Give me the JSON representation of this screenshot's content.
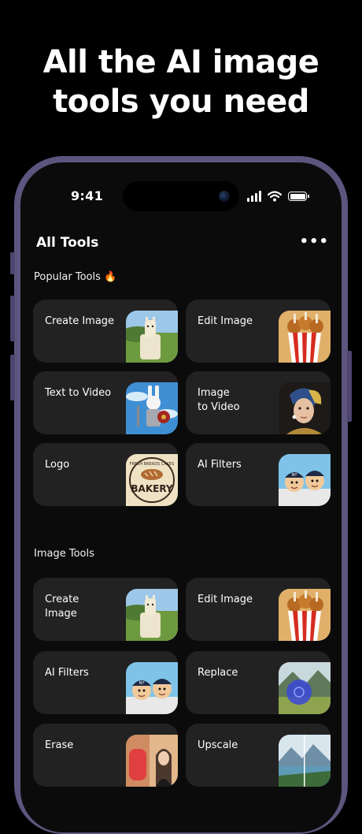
{
  "headline": [
    "All the AI image",
    "tools you need"
  ],
  "status_bar": {
    "time": "9:41"
  },
  "app": {
    "title": "All Tools",
    "more_label": "•••"
  },
  "sections": [
    {
      "title": "Popular Tools 🔥",
      "cards": [
        {
          "label": "Create Image",
          "thumb": "alpaca-image"
        },
        {
          "label": "Edit Image",
          "thumb": "fried-chicken-bucket-image"
        },
        {
          "label": "Text to Video",
          "thumb": "rabbit-knight-image"
        },
        {
          "label": "Image\nto Video",
          "thumb": "pearl-earring-portrait-image"
        },
        {
          "label": "Logo",
          "thumb": "bakery-logo-image",
          "thumb_text": [
            "FRESH BREADS CAKES",
            "BAKERY"
          ]
        },
        {
          "label": "AI Filters",
          "thumb": "cartoon-baseball-image",
          "thumb_text": [
            "NY"
          ]
        }
      ]
    },
    {
      "title": "Image Tools",
      "cards": [
        {
          "label": "Create\nImage",
          "thumb": "alpaca-image"
        },
        {
          "label": "Edit Image",
          "thumb": "fried-chicken-bucket-image"
        },
        {
          "label": "AI Filters",
          "thumb": "cartoon-baseball-image",
          "thumb_text": [
            "NY"
          ]
        },
        {
          "label": "Replace",
          "thumb": "landscape-replace-image"
        },
        {
          "label": "Erase",
          "thumb": "erase-portrait-image"
        },
        {
          "label": "Upscale",
          "thumb": "mountain-lake-image"
        }
      ]
    }
  ]
}
